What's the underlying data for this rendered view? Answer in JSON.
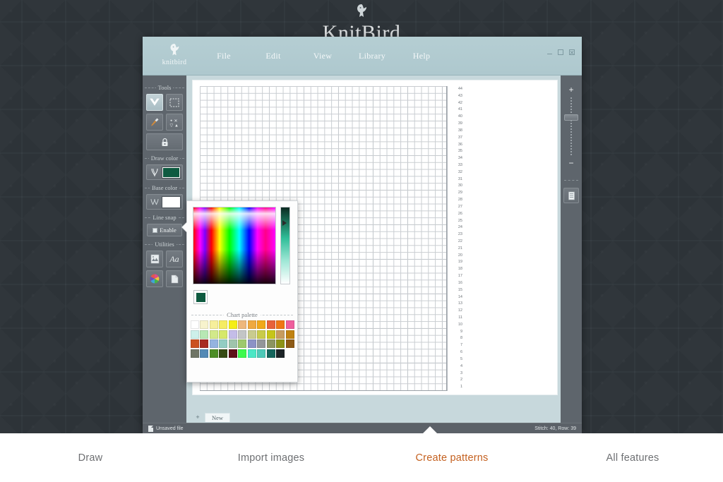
{
  "site": {
    "logo_icon": "bird-logo-icon",
    "wordmark": "KnitBird"
  },
  "app": {
    "logo_icon": "bird-logo-icon",
    "logo_text": "knitbird",
    "menu": [
      {
        "label": "File"
      },
      {
        "label": "Edit"
      },
      {
        "label": "View"
      },
      {
        "label": "Library"
      },
      {
        "label": "Help"
      }
    ],
    "window_controls": [
      {
        "name": "minimize-button",
        "icon": "minimize-icon"
      },
      {
        "name": "maximize-button",
        "icon": "maximize-icon"
      },
      {
        "name": "close-button",
        "icon": "close-icon"
      }
    ]
  },
  "toolbox": {
    "groups": [
      {
        "label": "Tools",
        "rows": [
          [
            {
              "name": "pick-stitch-tool",
              "icon": "chevron-down-icon",
              "active": true
            },
            {
              "name": "select-region-tool",
              "icon": "dashed-select-icon",
              "active": false
            }
          ],
          [
            {
              "name": "eyedropper-tool",
              "icon": "eyedropper-icon",
              "active": false
            },
            {
              "name": "magic-wand-tool",
              "icon": "magic-wand-icon",
              "active": false
            }
          ]
        ],
        "wide": {
          "name": "lock-tool",
          "icon": "lock-icon"
        }
      },
      {
        "label": "Draw color",
        "swatch": {
          "name": "draw-color-swatch",
          "icon": "stitch-icon",
          "color": "#0e5a40"
        }
      },
      {
        "label": "Base color",
        "swatch": {
          "name": "base-color-swatch",
          "icon": "knit-pattern-icon",
          "color": "#ffffff"
        }
      },
      {
        "label": "Line snap",
        "toggle": {
          "name": "line-snap-enable-toggle",
          "label": "Enable",
          "checked": false
        }
      },
      {
        "label": "Utilities",
        "rows": [
          [
            {
              "name": "image-import-tool",
              "icon": "image-icon",
              "active": false
            },
            {
              "name": "text-tool",
              "icon": "text-Aa-icon",
              "active": false
            }
          ],
          [
            {
              "name": "color-wheel-tool",
              "icon": "color-wheel-icon",
              "active": false
            },
            {
              "name": "document-tool",
              "icon": "document-icon",
              "active": false
            }
          ]
        ]
      }
    ]
  },
  "chart": {
    "row_numbers": [
      44,
      43,
      42,
      41,
      40,
      39,
      38,
      37,
      36,
      35,
      34,
      33,
      32,
      31,
      30,
      29,
      28,
      27,
      26,
      25,
      24,
      23,
      22,
      21,
      20,
      19,
      18,
      17,
      16,
      15,
      14,
      13,
      12,
      11,
      10,
      9,
      8,
      7,
      6,
      5,
      4,
      3,
      2,
      1
    ],
    "columns": 35,
    "rows": 44,
    "tabs": [
      {
        "label": "New",
        "active": true
      }
    ],
    "add_tab_label": "+"
  },
  "zoom_rail": {
    "zoom_in_label": "+",
    "zoom_out_label": "−",
    "document_button": "document-icon"
  },
  "statusbar": {
    "file_state": "Unsaved file",
    "position": "Stitch: 40, Row: 39"
  },
  "color_picker": {
    "title": "",
    "picked_color": "#0e5a40",
    "palette_label": "Chart palette",
    "palette": [
      "#ffffff",
      "#f7f3cd",
      "#f6ef9b",
      "#f5ec62",
      "#f5ee16",
      "#eeb77c",
      "#efa940",
      "#f0a81a",
      "#e8623a",
      "#ef7715",
      "#ef5f9d",
      "#cdf0ea",
      "#b7e8b4",
      "#d2e98a",
      "#d6e86a",
      "#c4bde8",
      "#c3c5c6",
      "#c9cb8e",
      "#c9cb4a",
      "#c6c51a",
      "#c79c5e",
      "#c08211",
      "#cb5220",
      "#a82b20",
      "#94b3e0",
      "#93cdc3",
      "#9fc4ac",
      "#9dc96d",
      "#8c92c6",
      "#93969a",
      "#8c9460",
      "#8d9318",
      "#8d5a16",
      "#6f7566",
      "#5389b5",
      "#4d8e26",
      "#364a12",
      "#5e1018",
      "#3dfa4d",
      "#4ae7c5",
      "#4dc9b8",
      "#14655c",
      "#1c2326",
      ""
    ],
    "palette_columns": 11
  },
  "feature_nav": [
    {
      "label": "Draw",
      "active": false
    },
    {
      "label": "Import images",
      "active": false
    },
    {
      "label": "Create patterns",
      "active": true
    },
    {
      "label": "All features",
      "active": false
    }
  ],
  "colors": {
    "accent": "#c4601f",
    "titlebar": "#b0cad0",
    "panel": "#5e656c",
    "canvas_bg": "#c7d8dc",
    "page_bg": "#383f45"
  }
}
